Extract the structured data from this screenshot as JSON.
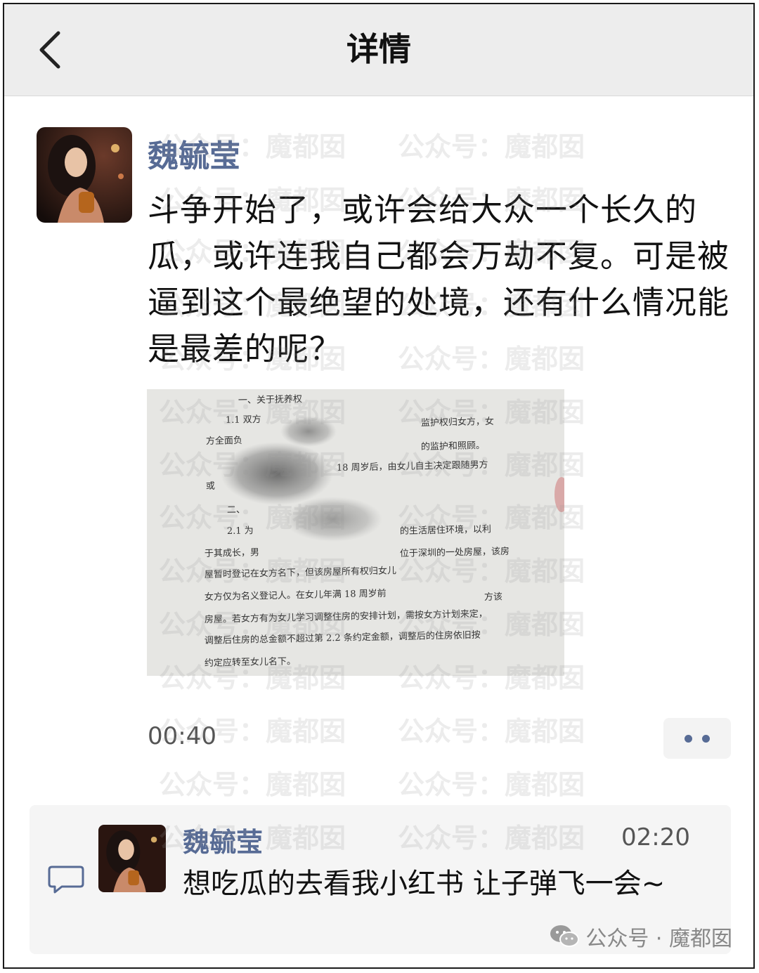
{
  "header": {
    "title": "详情"
  },
  "post": {
    "author": "魏毓莹",
    "text": "斗争开始了，或许会给大众一个长久的瓜，或许连我自己都会万劫不复。可是被逼到这个最绝望的处境，还有什么情况能是最差的呢？",
    "time": "00:40",
    "photo_lines": [
      "一、关于抚养权",
      "1.1 双方",
      "监护权归女方，女",
      "方全面负",
      "的监护和照顾。",
      "18 周岁后，由女儿自主决定跟随男方",
      "或",
      "二、",
      "2.1 为",
      "的生活居住环境，以利",
      "于其成长，男",
      "位于深圳的一处房屋，该房",
      "屋暂时登记在女方名下，但该房屋所有权归女儿",
      "女方仅为名义登记人。在女儿年满 18 周岁前",
      "方该",
      "房屋。若女方有为女儿学习调整住房的安排计划，需按女方计划来定，",
      "调整后住房的总金额不超过第 2.2 条约定金额，调整后的住房依旧按",
      "约定应转至女儿名下。"
    ]
  },
  "comment": {
    "author": "魏毓莹",
    "time": "02:20",
    "text": "想吃瓜的去看我小红书 让子弹飞一会~"
  },
  "watermark": {
    "text": "公众号：魔都囡",
    "footer": "公众号 · 魔都囡"
  },
  "colors": {
    "link": "#576b95",
    "header_bg": "#ededed",
    "comment_bg": "#f5f5f5"
  },
  "icons": {
    "back": "chevron-left-icon",
    "more": "more-dots-icon",
    "comment": "comment-bubble-icon",
    "wechat": "wechat-logo-icon"
  }
}
